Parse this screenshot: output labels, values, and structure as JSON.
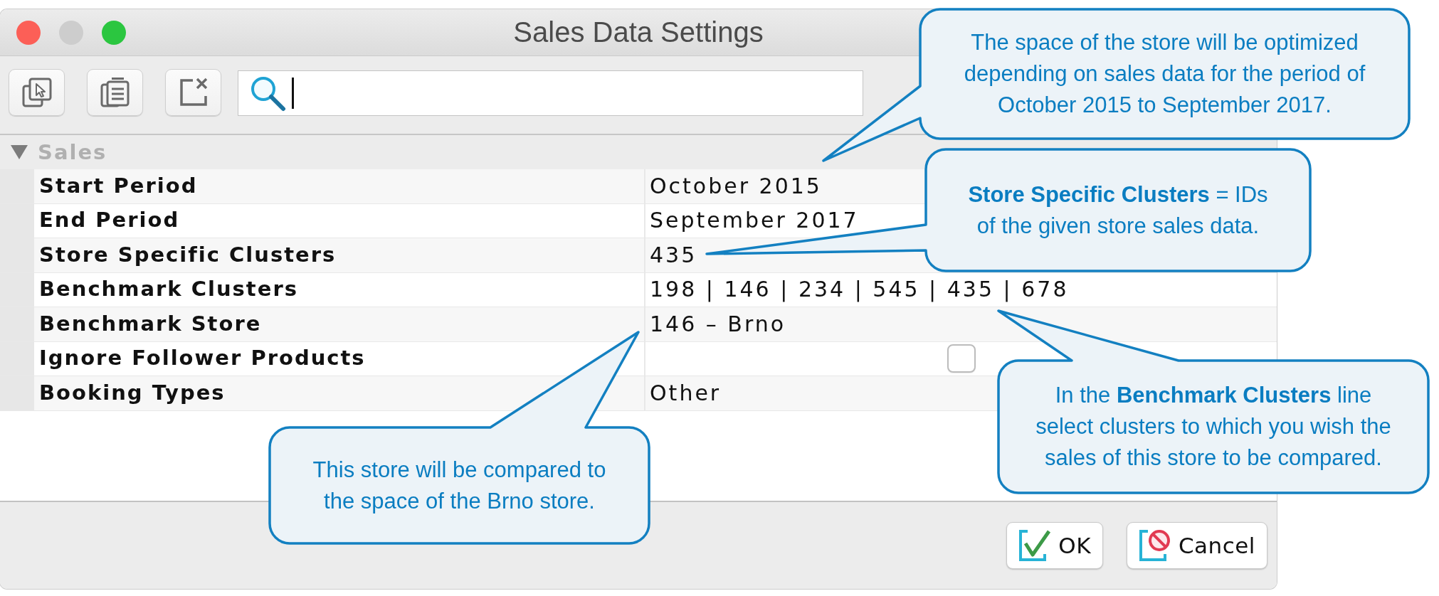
{
  "window": {
    "title": "Sales Data Settings",
    "controls": [
      {
        "color": "#fc5f57"
      },
      {
        "color": "#cdcdcd"
      },
      {
        "color": "#2bc640"
      }
    ]
  },
  "section": {
    "title": "Sales",
    "expanded": true,
    "rows": [
      {
        "kind": "text",
        "name": "Start Period",
        "value": "October 2015"
      },
      {
        "kind": "text",
        "name": "End Period",
        "value": "September 2017"
      },
      {
        "kind": "text",
        "name": "Store Specific Clusters",
        "value": "435"
      },
      {
        "kind": "text",
        "name": "Benchmark Clusters",
        "value": "198 | 146 | 234 | 545 | 435 | 678"
      },
      {
        "kind": "text",
        "name": "Benchmark Store",
        "value": "146 – Brno"
      },
      {
        "kind": "checkbox",
        "name": "Ignore Follower Products",
        "checked": false
      },
      {
        "kind": "text",
        "name": "Booking Types",
        "value": "Other"
      }
    ]
  },
  "buttons": [
    {
      "kind": "confirm",
      "label": "OK"
    },
    {
      "kind": "cancel",
      "label": "Cancel"
    }
  ],
  "callouts": [
    {
      "text": "The space of the store will be optimized depending on sales data for the period of October 2015 to September 2017."
    },
    {
      "text": "**Store Specific Clusters** = IDs of the given store sales data."
    },
    {
      "text": "In the **Benchmark Clusters** line select clusters to which you wish the sales of this store to be compared."
    },
    {
      "text": "This store will be compared to the space of the Brno store."
    }
  ]
}
